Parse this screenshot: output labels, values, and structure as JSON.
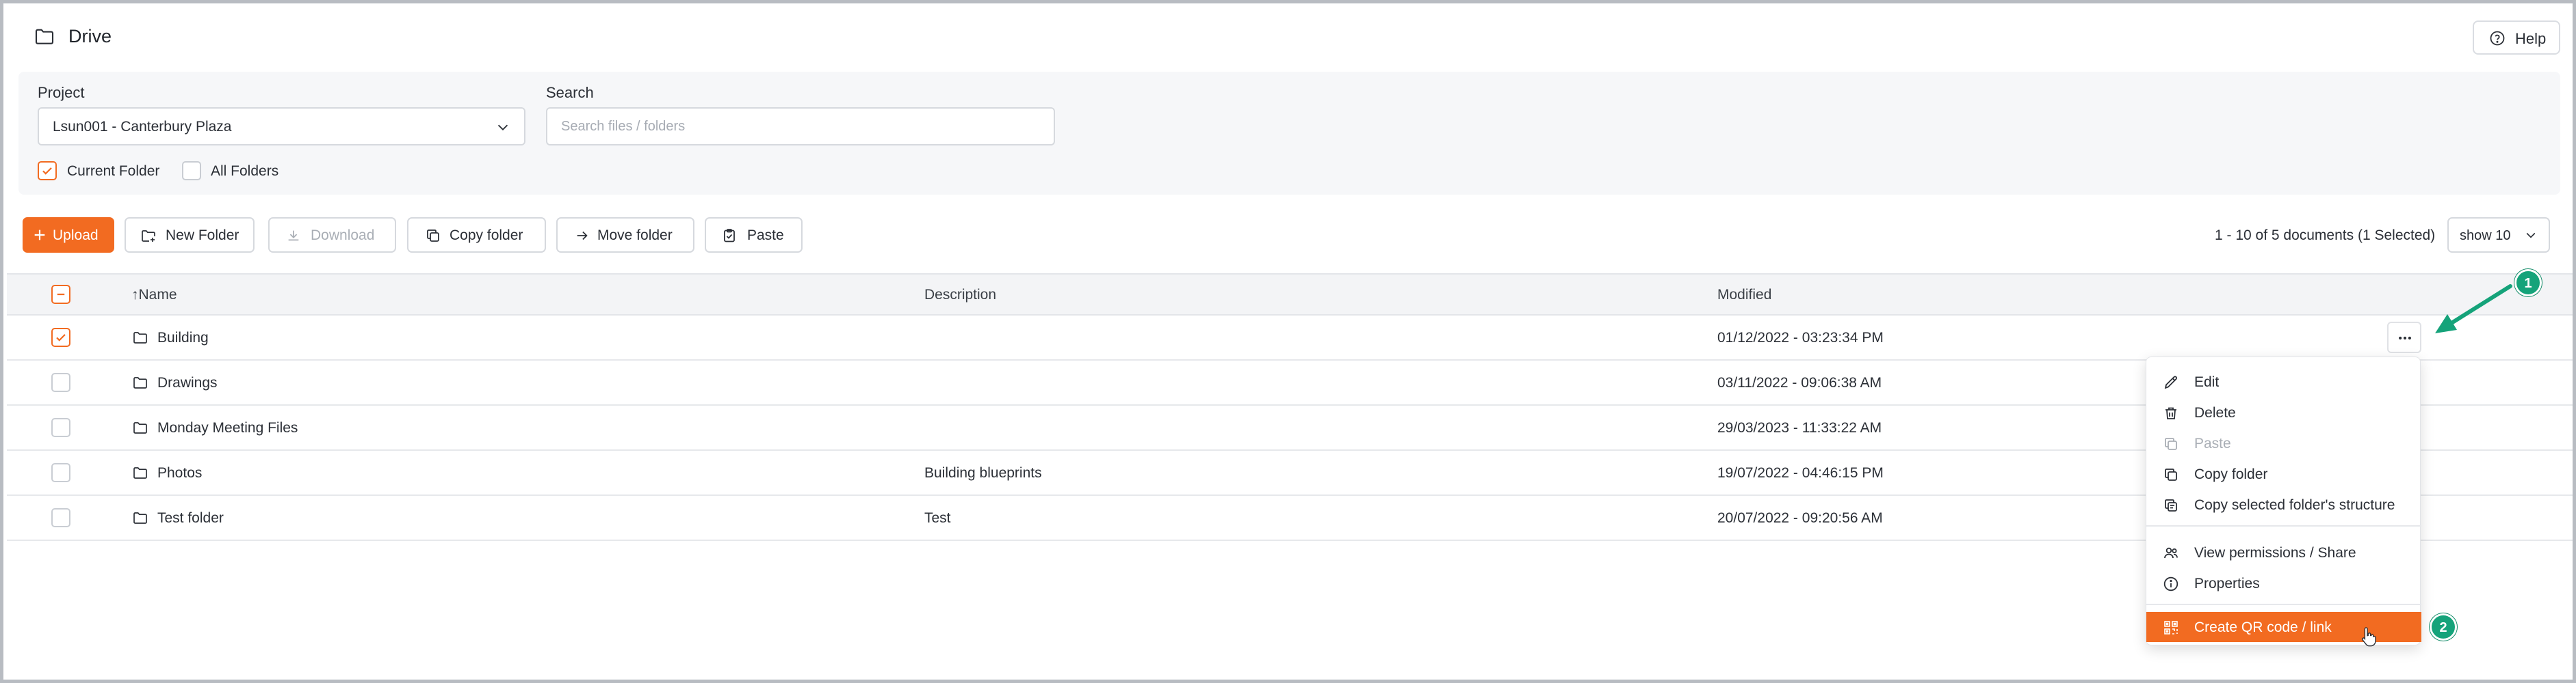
{
  "header": {
    "title": "Drive",
    "help_label": "Help"
  },
  "filters": {
    "project_label": "Project",
    "project_value": "Lsun001 - Canterbury Plaza",
    "search_label": "Search",
    "search_placeholder": "Search files / folders",
    "current_folder_label": "Current Folder",
    "current_folder_checked": true,
    "all_folders_label": "All Folders",
    "all_folders_checked": false
  },
  "toolbar": {
    "upload_label": "Upload",
    "new_folder_label": "New Folder",
    "download_label": "Download",
    "copy_folder_label": "Copy folder",
    "move_folder_label": "Move folder",
    "paste_label": "Paste",
    "count_text": "1 - 10 of 5 documents (1 Selected)",
    "page_size_label": "show 10"
  },
  "table": {
    "columns": {
      "name": "↑Name",
      "description": "Description",
      "modified": "Modified"
    },
    "rows": [
      {
        "name": "Building",
        "description": "",
        "modified": "01/12/2022 - 03:23:34 PM",
        "selected": true
      },
      {
        "name": "Drawings",
        "description": "",
        "modified": "03/11/2022 - 09:06:38 AM",
        "selected": false
      },
      {
        "name": "Monday Meeting Files",
        "description": "",
        "modified": "29/03/2023 - 11:33:22 AM",
        "selected": false
      },
      {
        "name": "Photos",
        "description": "Building blueprints",
        "modified": "19/07/2022 - 04:46:15 PM",
        "selected": false
      },
      {
        "name": "Test folder",
        "description": "Test",
        "modified": "20/07/2022 - 09:20:56 AM",
        "selected": false
      }
    ]
  },
  "context_menu": {
    "items": [
      {
        "label": "Edit",
        "icon": "pencil-icon",
        "disabled": false
      },
      {
        "label": "Delete",
        "icon": "trash-icon",
        "disabled": false
      },
      {
        "label": "Paste",
        "icon": "paste-icon",
        "disabled": true
      },
      {
        "label": "Copy folder",
        "icon": "copy-icon",
        "disabled": false
      },
      {
        "label": "Copy selected folder's structure",
        "icon": "copy-structure-icon",
        "disabled": false
      },
      {
        "label": "View permissions / Share",
        "icon": "users-icon",
        "disabled": false
      },
      {
        "label": "Properties",
        "icon": "info-icon",
        "disabled": false
      },
      {
        "label": "Create QR code / link",
        "icon": "qr-code-icon",
        "disabled": false,
        "active": true
      }
    ]
  },
  "annotations": {
    "badge_1": "1",
    "badge_2": "2"
  },
  "colors": {
    "accent": "#f26b21",
    "annotation": "#15a37a"
  }
}
